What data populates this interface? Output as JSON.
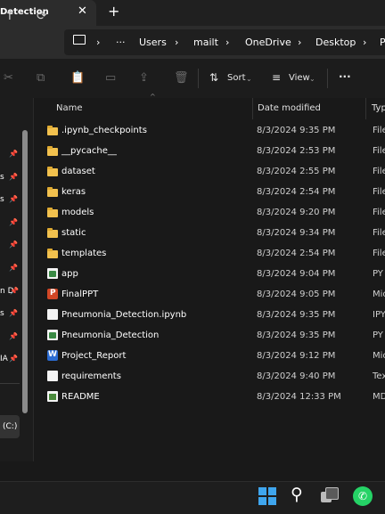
{
  "window": {
    "tab_title": "Detection",
    "tab_close": "✕",
    "new_tab": "+"
  },
  "address": {
    "crumbs": [
      "Users",
      "mailt",
      "OneDrive",
      "Desktop",
      "P"
    ],
    "ellipsis": "···",
    "separator": "›"
  },
  "toolbar": {
    "sort_label": "Sort",
    "view_label": "View",
    "more_label": "···"
  },
  "sidebar": {
    "fragments": [
      "s",
      "s",
      "n D",
      "s",
      "IA"
    ],
    "drive_label": "(C:)"
  },
  "columns": {
    "name": "Name",
    "date": "Date modified",
    "type": "Typ"
  },
  "files": [
    {
      "name": ".ipynb_checkpoints",
      "date": "8/3/2024 9:35 PM",
      "type": "File",
      "icon": "folder-icon"
    },
    {
      "name": "__pycache__",
      "date": "8/3/2024 2:53 PM",
      "type": "File",
      "icon": "folder-icon"
    },
    {
      "name": "dataset",
      "date": "8/3/2024 2:55 PM",
      "type": "File",
      "icon": "folder-icon"
    },
    {
      "name": "keras",
      "date": "8/3/2024 2:54 PM",
      "type": "File",
      "icon": "folder-icon"
    },
    {
      "name": "models",
      "date": "8/3/2024 9:20 PM",
      "type": "File",
      "icon": "folder-icon"
    },
    {
      "name": "static",
      "date": "8/3/2024 9:34 PM",
      "type": "File",
      "icon": "folder-icon"
    },
    {
      "name": "templates",
      "date": "8/3/2024 2:54 PM",
      "type": "File",
      "icon": "folder-icon"
    },
    {
      "name": "app",
      "date": "8/3/2024 9:04 PM",
      "type": "PY",
      "icon": "python-file-icon"
    },
    {
      "name": "FinalPPT",
      "date": "8/3/2024 9:05 PM",
      "type": "Mic",
      "icon": "powerpoint-file-icon"
    },
    {
      "name": "Pneumonia_Detection.ipynb",
      "date": "8/3/2024 9:35 PM",
      "type": "IPY",
      "icon": "file-icon"
    },
    {
      "name": "Pneumonia_Detection",
      "date": "8/3/2024 9:35 PM",
      "type": "PY",
      "icon": "python-file-icon"
    },
    {
      "name": "Project_Report",
      "date": "8/3/2024 9:12 PM",
      "type": "Mic",
      "icon": "word-file-icon"
    },
    {
      "name": "requirements",
      "date": "8/3/2024 9:40 PM",
      "type": "Tex",
      "icon": "file-icon"
    },
    {
      "name": "README",
      "date": "8/3/2024 12:33 PM",
      "type": "MD",
      "icon": "markdown-file-icon"
    }
  ],
  "colors": {
    "background": "#191919",
    "folder": "#f2c14e",
    "windows_blue": "#3fa6ee",
    "whatsapp_green": "#25d366"
  }
}
